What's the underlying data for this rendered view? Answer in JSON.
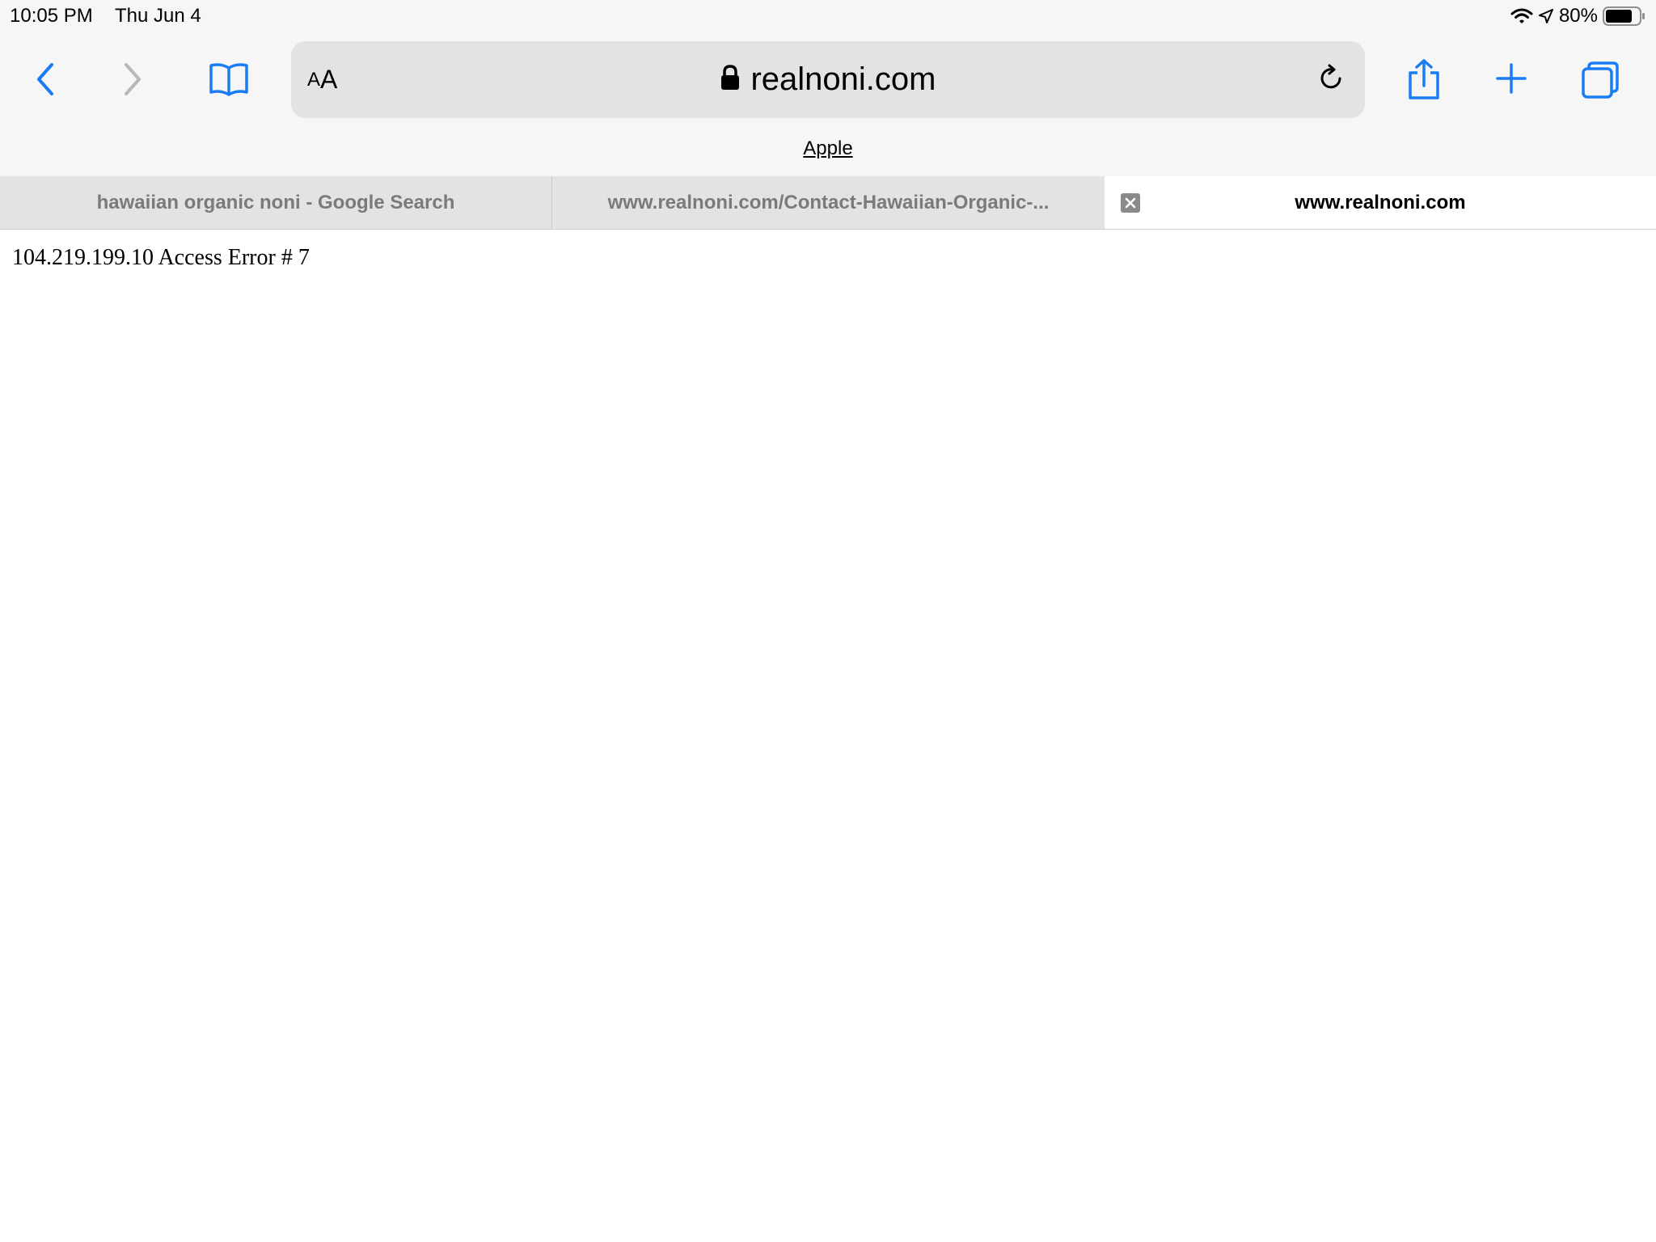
{
  "status_bar": {
    "time": "10:05 PM",
    "date": "Thu Jun 4",
    "battery": "80%",
    "battery_level": 0.8,
    "icons": [
      "wifi-icon",
      "location-arrow-icon",
      "battery-icon"
    ]
  },
  "toolbar": {
    "icons": [
      "back-chevron-icon",
      "forward-chevron-icon",
      "bookmarks-book-icon",
      "share-icon",
      "plus-icon",
      "tabs-overview-icon"
    ],
    "accent_color": "#1a7cf5"
  },
  "address_bar": {
    "aa_small": "A",
    "aa_big": "A",
    "url": "realnoni.com",
    "lock_icon": "lock-icon",
    "reload_icon": "reload-icon"
  },
  "favorites_bar": {
    "items": [
      "Apple"
    ]
  },
  "tabs": [
    {
      "title": "hawaiian organic noni - Google Search",
      "active": false
    },
    {
      "title": "www.realnoni.com/Contact-Hawaiian-Organic-...",
      "active": false
    },
    {
      "title": "www.realnoni.com",
      "active": true
    }
  ],
  "page": {
    "text": "104.219.199.10 Access Error # 7"
  }
}
